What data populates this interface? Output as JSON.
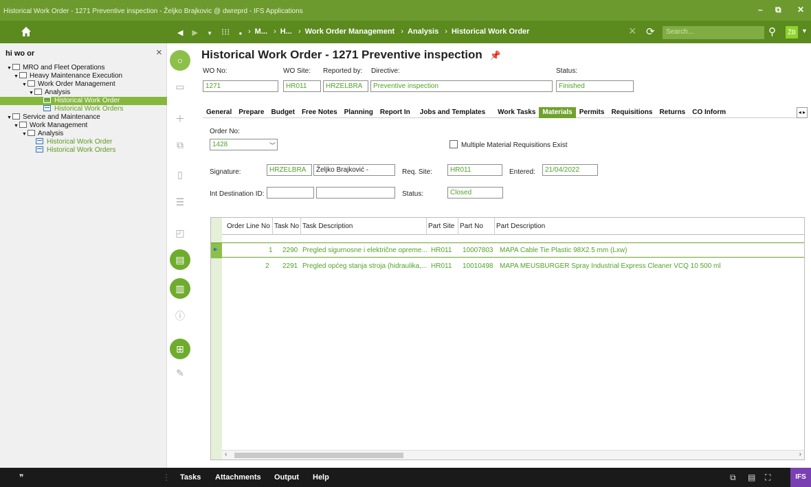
{
  "window": {
    "title": "Historical Work Order - 1271 Preventive inspection - Željko Brajkovic @ dwreprd - IFS Applications"
  },
  "nav": {
    "breadcrumb": [
      "M...",
      "H...",
      "Work Order Management",
      "Analysis",
      "Historical Work Order"
    ],
    "search_placeholder": "Search...",
    "user_initials": "ŽB"
  },
  "left_panel": {
    "search_text": "hi wo or",
    "tree": [
      {
        "label": "MRO and Fleet Operations",
        "level": 0,
        "type": "folder"
      },
      {
        "label": "Heavy Maintenance Execution",
        "level": 1,
        "type": "folder"
      },
      {
        "label": "Work Order Management",
        "level": 2,
        "type": "folder"
      },
      {
        "label": "Analysis",
        "level": 3,
        "type": "folder"
      },
      {
        "label": "Historical Work Order",
        "level": 4,
        "type": "page",
        "selected": true
      },
      {
        "label": "Historical Work Orders",
        "level": 4,
        "type": "page"
      },
      {
        "label": "Service and Maintenance",
        "level": 0,
        "type": "folder"
      },
      {
        "label": "Work Management",
        "level": 1,
        "type": "folder"
      },
      {
        "label": "Analysis",
        "level": 2,
        "type": "folder"
      },
      {
        "label": "Historical Work Order",
        "level": 3,
        "type": "page"
      },
      {
        "label": "Historical Work Orders",
        "level": 3,
        "type": "page"
      }
    ]
  },
  "header": {
    "title": "Historical Work Order - 1271 Preventive inspection",
    "labels": {
      "wo_no": "WO No:",
      "wo_site": "WO Site:",
      "reported_by": "Reported by:",
      "directive": "Directive:",
      "status": "Status:"
    },
    "values": {
      "wo_no": "1271",
      "wo_site": "HR011",
      "reported_by": "HRZELBRA",
      "directive": "Preventive inspection",
      "status": "Finished"
    }
  },
  "tabs": [
    "General",
    "Prepare",
    "Budget",
    "Free Notes",
    "Planning",
    "Report In",
    "Jobs and Templates",
    "Work Tasks",
    "Materials",
    "Permits",
    "Requisitions",
    "Returns",
    "CO Inform"
  ],
  "active_tab": "Materials",
  "materials": {
    "labels": {
      "order_no": "Order No:",
      "multiple": "Multiple Material Requisitions Exist",
      "signature": "Signature:",
      "req_site": "Req. Site:",
      "entered": "Entered:",
      "int_destination": "Int Destination ID:",
      "status": "Status:"
    },
    "values": {
      "order_no": "1428",
      "signature_id": "HRZELBRA",
      "signature_name": "Željko Brajković -",
      "req_site": "HR011",
      "entered": "21/04/2022",
      "int_destination_id": "",
      "int_destination_desc": "",
      "status": "Closed"
    },
    "table": {
      "columns": [
        "Order Line No",
        "Task No",
        "Task Description",
        "Part Site",
        "Part No",
        "Part Description"
      ],
      "rows": [
        {
          "line": "1",
          "task": "2290",
          "desc": "Pregled sigurnosne i električne opreme...",
          "site": "HR011",
          "part": "10007803",
          "part_desc": "MAPA Cable Tie Plastic 98X2.5 mm (Lxw)"
        },
        {
          "line": "2",
          "task": "2291",
          "desc": "Pregled općeg stanja stroja (hidraulika,...",
          "site": "HR011",
          "part": "10010498",
          "part_desc": "MAPA MEUSBURGER Spray Industrial Express Cleaner VCQ 10 500 ml"
        }
      ]
    }
  },
  "bottom_bar": {
    "items": [
      "Tasks",
      "Attachments",
      "Output",
      "Help"
    ],
    "logo": "IFS"
  }
}
